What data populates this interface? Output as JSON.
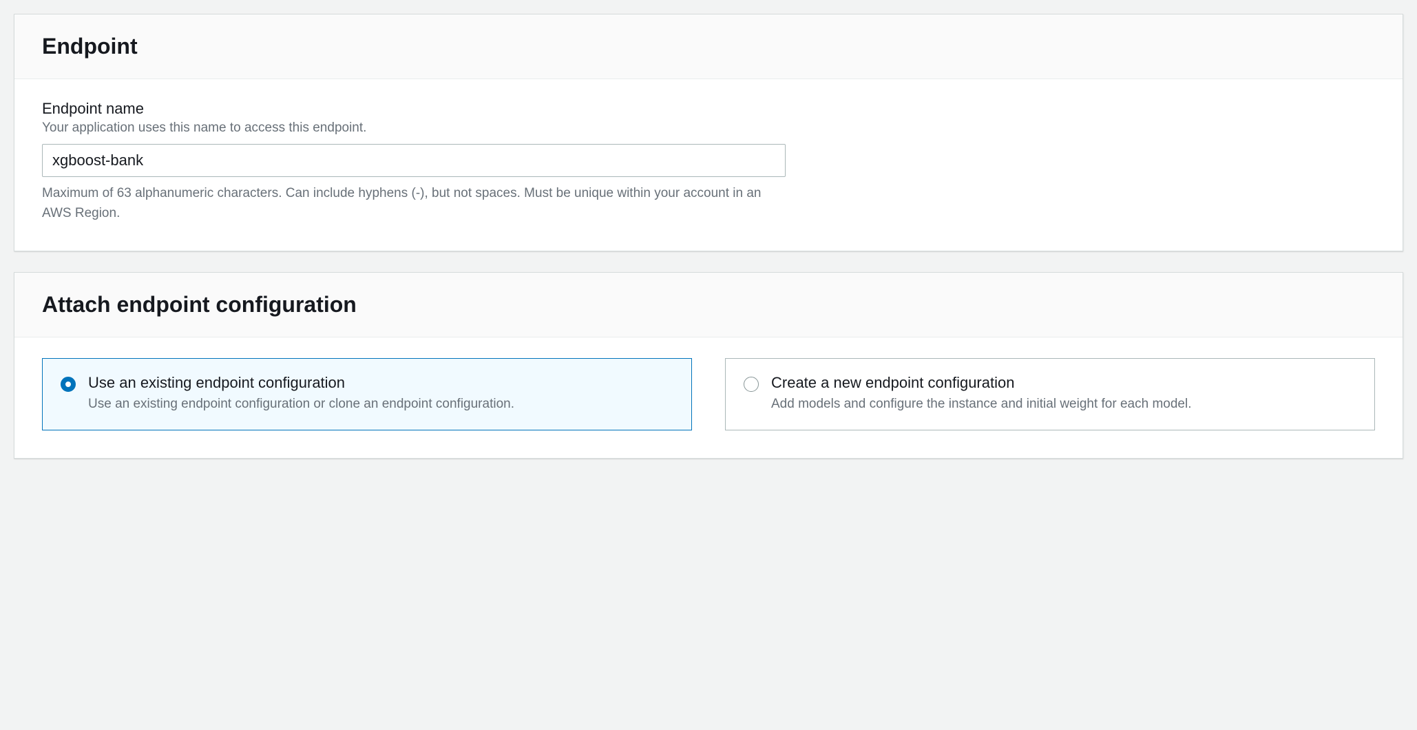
{
  "endpoint_panel": {
    "title": "Endpoint",
    "name_field": {
      "label": "Endpoint name",
      "description": "Your application uses this name to access this endpoint.",
      "value": "xgboost-bank",
      "constraint": "Maximum of 63 alphanumeric characters. Can include hyphens (-), but not spaces. Must be unique within your account in an AWS Region."
    }
  },
  "config_panel": {
    "title": "Attach endpoint configuration",
    "options": [
      {
        "title": "Use an existing endpoint configuration",
        "description": "Use an existing endpoint configuration or clone an endpoint configuration.",
        "selected": true
      },
      {
        "title": "Create a new endpoint configuration",
        "description": "Add models and configure the instance and initial weight for each model.",
        "selected": false
      }
    ]
  }
}
